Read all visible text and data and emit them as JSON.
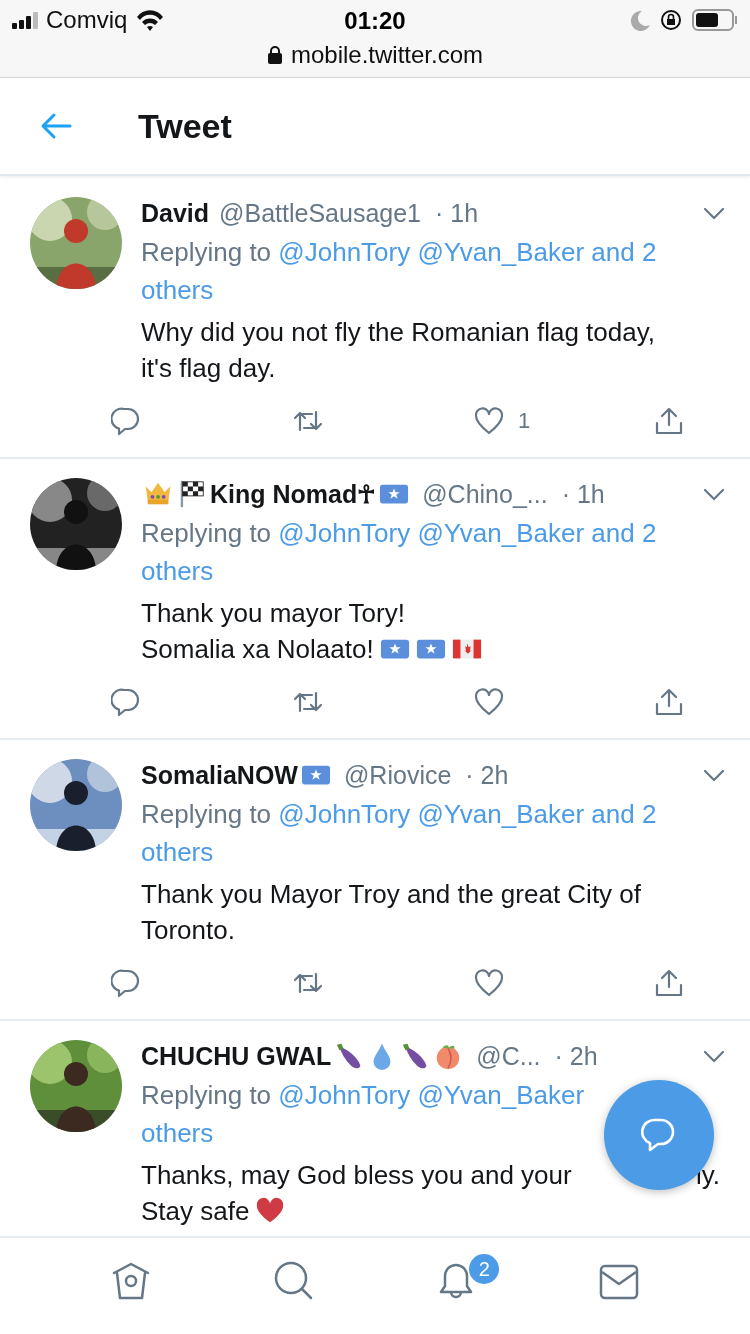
{
  "status_bar": {
    "carrier": "Comviq",
    "time": "01:20",
    "url": "mobile.twitter.com"
  },
  "header": {
    "title": "Tweet"
  },
  "tweets": [
    {
      "avatar": {
        "kind": "picture"
      },
      "name": "David",
      "handle": "@BattleSausage1",
      "time": "· 1h",
      "reply": {
        "prefix": "Replying to",
        "lines": [
          [
            "@JohnTory",
            "@Yvan_Baker",
            "and 2"
          ],
          [
            "others"
          ]
        ]
      },
      "body": [
        {
          "text": "Why did you not fly the Romanian flag today,"
        },
        {
          "text": "it's flag day."
        }
      ],
      "actions_shown": true,
      "likes": "1"
    },
    {
      "avatar": {
        "kind": "picture"
      },
      "name": "King Nomad☥",
      "icons_before": [
        {
          "kind": "crown"
        },
        {
          "kind": "checkered"
        }
      ],
      "icons_after": [
        {
          "kind": "somali"
        }
      ],
      "handle": "@Chino_...",
      "time": "· 1h",
      "reply": {
        "prefix": "Replying to",
        "lines": [
          [
            "@JohnTory",
            "@Yvan_Baker",
            "and 2"
          ],
          [
            "others"
          ]
        ]
      },
      "body": [
        {
          "text": "Thank you mayor Tory!"
        },
        {
          "text": "Somalia xa Nolaato!",
          "icons": [
            {
              "kind": "somali"
            },
            {
              "kind": "somali"
            },
            {
              "kind": "canada"
            }
          ]
        }
      ],
      "actions_shown": true
    },
    {
      "avatar": {
        "kind": "picture"
      },
      "name": "SomaliaNOW",
      "icons_after": [
        {
          "kind": "somali"
        }
      ],
      "handle": "@Riovice",
      "time": "· 2h",
      "reply": {
        "prefix": "Replying to",
        "lines": [
          [
            "@JohnTory",
            "@Yvan_Baker",
            "and 2"
          ],
          [
            "others"
          ]
        ]
      },
      "body": [
        {
          "text": "Thank you Mayor Troy and the great City of"
        },
        {
          "text": "Toronto."
        }
      ],
      "actions_shown": true
    },
    {
      "avatar": {
        "kind": "picture"
      },
      "name": "CHUCHU GWAL",
      "icons_after": [
        {
          "kind": "eggplant"
        },
        {
          "kind": "droplet"
        },
        {
          "kind": "eggplant"
        },
        {
          "kind": "peach"
        }
      ],
      "handle": "@C...",
      "time": "· 2h",
      "reply": {
        "prefix": "Replying to",
        "lines": [
          [
            "@JohnTory",
            "@Yvan_Baker"
          ],
          [
            "others"
          ]
        ]
      },
      "body": [
        {
          "text": "Thanks, may God bless you and your",
          "text_right": "ly."
        },
        {
          "text": "Stay safe",
          "icons": [
            {
              "kind": "heart"
            }
          ]
        }
      ],
      "actions_shown": false
    }
  ],
  "bottom_nav": [
    {
      "kind": "home"
    },
    {
      "kind": "search"
    },
    {
      "kind": "bell",
      "badge": "2"
    },
    {
      "kind": "mail"
    }
  ]
}
